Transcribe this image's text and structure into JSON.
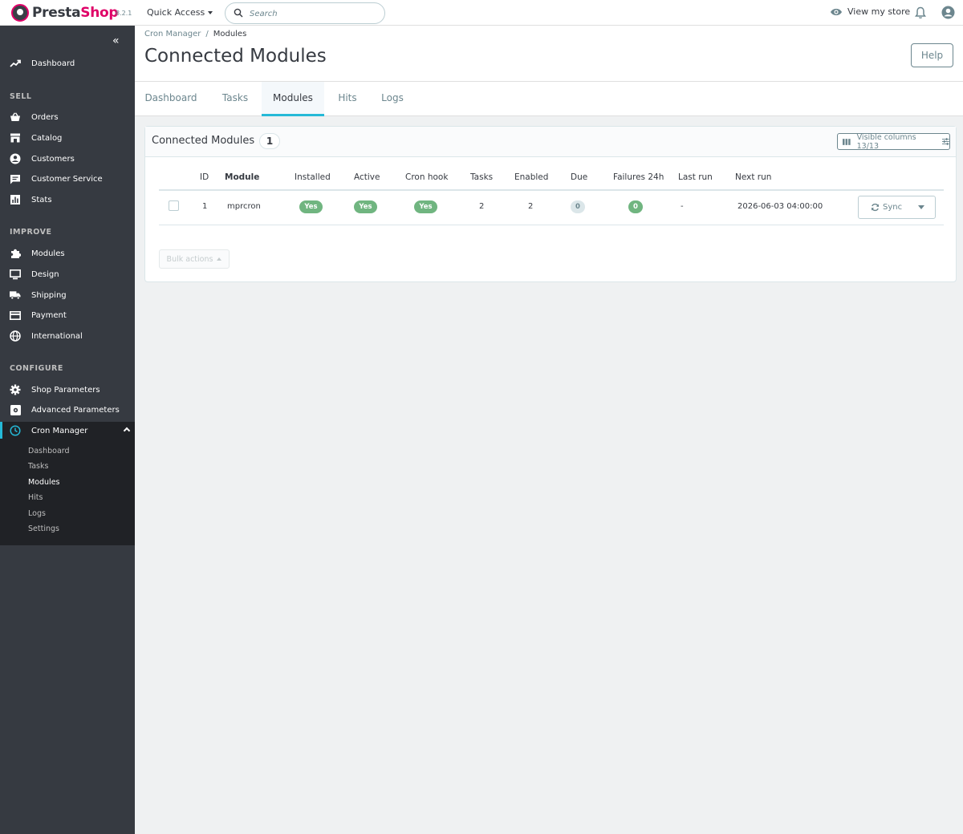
{
  "header": {
    "brand_presta": "Presta",
    "brand_shop": "Shop",
    "version": "8.2.1",
    "quick_access": "Quick Access",
    "search_placeholder": "Search",
    "view_store": "View my store"
  },
  "sidebar": {
    "dashboard": "Dashboard",
    "sections": {
      "sell": "SELL",
      "improve": "IMPROVE",
      "configure": "CONFIGURE"
    },
    "sell_items": [
      "Orders",
      "Catalog",
      "Customers",
      "Customer Service",
      "Stats"
    ],
    "improve_items": [
      "Modules",
      "Design",
      "Shipping",
      "Payment",
      "International"
    ],
    "configure_items": [
      "Shop Parameters",
      "Advanced Parameters",
      "Cron Manager"
    ],
    "cron_sub_items": [
      "Dashboard",
      "Tasks",
      "Modules",
      "Hits",
      "Logs",
      "Settings"
    ],
    "current_sub_item": "Modules"
  },
  "breadcrumb": {
    "parent": "Cron Manager",
    "separator": "/",
    "current": "Modules"
  },
  "page": {
    "title": "Connected Modules",
    "help_label": "Help"
  },
  "tabs": [
    "Dashboard",
    "Tasks",
    "Modules",
    "Hits",
    "Logs"
  ],
  "active_tab": "Modules",
  "panel": {
    "title": "Connected Modules",
    "count": "1",
    "visible_columns": "Visible columns 13/13",
    "bulk_actions": "Bulk actions"
  },
  "table": {
    "columns": [
      "ID",
      "Module",
      "Installed",
      "Active",
      "Cron hook",
      "Tasks",
      "Enabled",
      "Due",
      "Failures 24h",
      "Last run",
      "Next run"
    ],
    "rows": [
      {
        "id": "1",
        "module": "mprcron",
        "installed": "Yes",
        "active": "Yes",
        "cron_hook": "Yes",
        "tasks": "2",
        "enabled": "2",
        "due": "0",
        "failures_24h": "0",
        "last_run": "-",
        "next_run": "2026-06-03 04:00:00",
        "action": "Sync"
      }
    ]
  },
  "colors": {
    "sidebar_bg": "#363a41",
    "sidebar_active_bg": "#202226",
    "accent": "#25b9d7",
    "brand_pink": "#df0067",
    "success": "#70b580"
  }
}
